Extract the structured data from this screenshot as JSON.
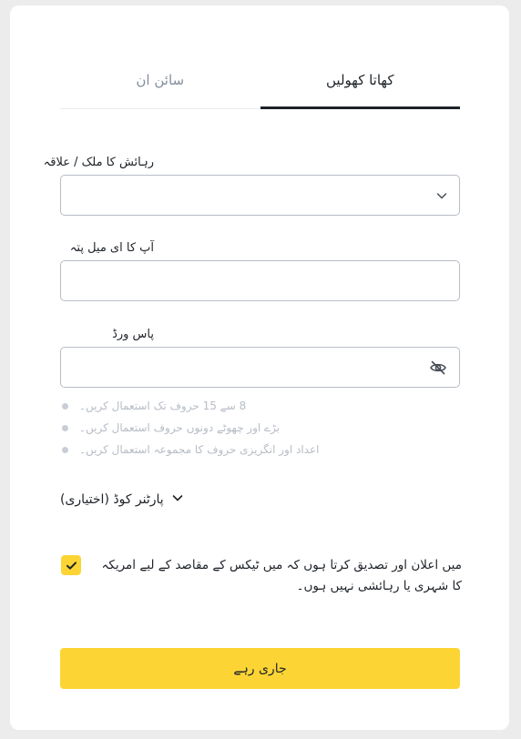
{
  "tabs": [
    {
      "label": "کھاتا کھولیں",
      "active": true
    },
    {
      "label": "سائن ان",
      "active": false
    }
  ],
  "country": {
    "label": "رہائش کا ملک / علاقہ",
    "value": "",
    "icon": "chevron-down-icon"
  },
  "email": {
    "label": "آپ کا ای میل پتہ",
    "value": ""
  },
  "password": {
    "label": "پاس ورڈ",
    "value": "",
    "icon": "eye-off-icon"
  },
  "password_rules": [
    "8 سے 15 حروف تک استعمال کریں۔",
    "بڑے اور چھوٹے دونوں حروف استعمال کریں۔",
    "اعداد اور انگریزی حروف کا مجموعہ استعمال کریں۔"
  ],
  "referral": {
    "label": "پارٹنر کوڈ (اختیاری)",
    "icon": "chevron-down-icon"
  },
  "consent": {
    "checked": true,
    "text": "میں اعلان اور تصدیق کرتا ہوں کہ میں ٹیکس کے مقاصد کے لیے امریکہ کا شہری یا رہائشی نہیں ہوں۔"
  },
  "submit": {
    "label": "جاری رہے"
  },
  "colors": {
    "accent": "#fcd535",
    "text": "#1e2329",
    "muted": "#848e9c",
    "border": "#b7bdc6"
  }
}
